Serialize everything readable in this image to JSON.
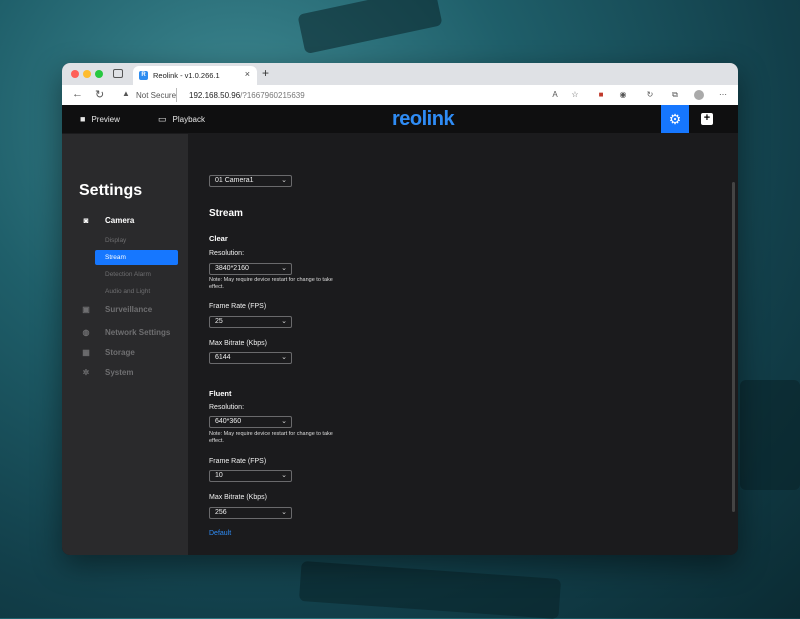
{
  "browser": {
    "tab_title": "Reolink - v1.0.266.1",
    "tab_favicon_letter": "R",
    "close_glyph": "×",
    "new_tab_glyph": "+",
    "back_glyph": "←",
    "reload_glyph": "↻",
    "security_label": "Not Secure",
    "url_host": "192.168.50.96",
    "url_path": "/?1667960215639"
  },
  "app": {
    "preview_label": "Preview",
    "playback_label": "Playback",
    "logo_text": "reolink",
    "accent_color": "#1677ff"
  },
  "sidebar": {
    "title": "Settings",
    "menu": {
      "camera": "Camera",
      "surveillance": "Surveillance",
      "network": "Network Settings",
      "storage": "Storage",
      "system": "System"
    },
    "camera_sub": {
      "display": "Display",
      "stream": "Stream",
      "detection_alarm": "Detection Alarm",
      "audio_light": "Audio and Light"
    }
  },
  "main": {
    "camera_select": "01   Camera1",
    "heading": "Stream",
    "clear": {
      "title": "Clear",
      "resolution_label": "Resolution:",
      "resolution_value": "3840*2160",
      "note": "Note: May require device restart for change to take effect.",
      "frame_rate_label": "Frame Rate (FPS)",
      "frame_rate_value": "25",
      "bitrate_label": "Max Bitrate (Kbps)",
      "bitrate_value": "6144"
    },
    "fluent": {
      "title": "Fluent",
      "resolution_label": "Resolution:",
      "resolution_value": "640*360",
      "note": "Note: May require device restart for change to take effect.",
      "frame_rate_label": "Frame Rate (FPS)",
      "frame_rate_value": "10",
      "bitrate_label": "Max Bitrate (Kbps)",
      "bitrate_value": "256"
    },
    "default_link": "Default"
  }
}
